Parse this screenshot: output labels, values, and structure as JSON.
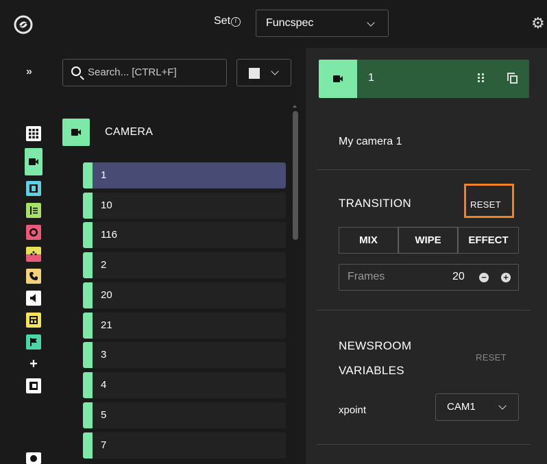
{
  "header": {
    "set_label": "Set",
    "set_value": "Funcspec"
  },
  "sidebar": {
    "rail_icons": [
      {
        "name": "grid-icon",
        "color": "#ffffff"
      },
      {
        "name": "camera-icon",
        "color": "#7ee8a9"
      },
      {
        "name": "film-icon",
        "color": "#5fd0e0"
      },
      {
        "name": "audio-script-icon",
        "color": "#a6e06b"
      },
      {
        "name": "record-icon",
        "color": "#e85a7a"
      },
      {
        "name": "transition-icon",
        "color": "#e8e05a"
      },
      {
        "name": "phone-icon",
        "color": "#f4d27a"
      },
      {
        "name": "speaker-icon",
        "color": "#ffffff"
      },
      {
        "name": "layout-icon",
        "color": "#f4e35a"
      },
      {
        "name": "flag-icon",
        "color": "#4ad6a8"
      },
      {
        "name": "plus-icon",
        "color": "#ffffff"
      },
      {
        "name": "graphic-icon",
        "color": "#ffffff"
      },
      {
        "name": "chart-icon",
        "color": "#ffffff"
      }
    ]
  },
  "search": {
    "placeholder": "Search... [CTRL+F]"
  },
  "list": {
    "header": "CAMERA",
    "items": [
      "1",
      "10",
      "116",
      "2",
      "20",
      "21",
      "3",
      "4",
      "5",
      "7"
    ]
  },
  "panel": {
    "header_number": "1",
    "camera_name": "My camera 1",
    "transition": {
      "title": "TRANSITION",
      "reset": "RESET",
      "options": [
        "MIX",
        "WIPE",
        "EFFECT"
      ],
      "active": "WIPE",
      "frames_label": "Frames",
      "frames_value": "20"
    },
    "newsroom": {
      "title_line1": "NEWSROOM",
      "title_line2": "VARIABLES",
      "reset": "RESET",
      "xpoint_label": "xpoint",
      "xpoint_value": "CAM1"
    }
  },
  "colors": {
    "accent_green": "#7ee8a9",
    "header_green": "#2d5e3b",
    "selected_row": "#474a73",
    "highlight_orange": "#f0822a",
    "active_segment_border": "#4a62b8"
  }
}
